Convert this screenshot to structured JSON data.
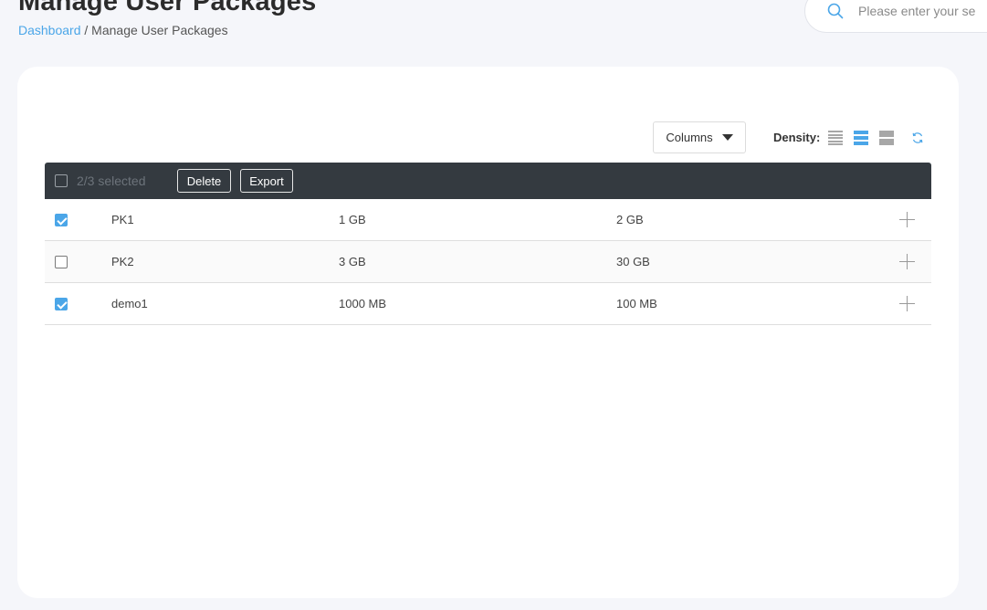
{
  "header": {
    "title": "Manage User Packages",
    "breadcrumb": {
      "home": "Dashboard",
      "separator": " / ",
      "current": "Manage User Packages"
    },
    "search": {
      "placeholder": "Please enter your se",
      "icon": "search-icon"
    }
  },
  "toolbar": {
    "columns_label": "Columns",
    "density_label": "Density:",
    "density_options": [
      "compact",
      "standard",
      "comfortable"
    ],
    "density_selected": "standard",
    "refresh_icon": "refresh-icon"
  },
  "table": {
    "selection_text": "2/3 selected",
    "actions": {
      "delete_label": "Delete",
      "export_label": "Export"
    },
    "rows": [
      {
        "name": "PK1",
        "col2": "1 GB",
        "col3": "2 GB",
        "checked": true
      },
      {
        "name": "PK2",
        "col2": "3 GB",
        "col3": "30 GB",
        "checked": false
      },
      {
        "name": "demo1",
        "col2": "1000 MB",
        "col3": "100 MB",
        "checked": true
      }
    ]
  },
  "colors": {
    "accent": "#4ba6e8",
    "table_header_bg": "#343a40",
    "page_bg": "#f5f6fa"
  }
}
